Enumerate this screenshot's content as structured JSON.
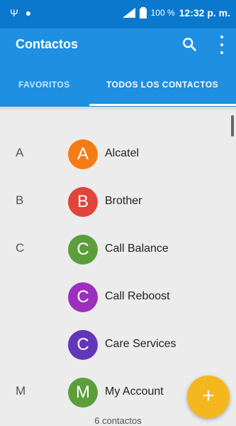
{
  "status_bar": {
    "battery": "100 %",
    "time": "12:32 p. m."
  },
  "app_bar": {
    "title": "Contactos"
  },
  "tabs": [
    {
      "label": "FAVORITOS"
    },
    {
      "label": "TODOS LOS CONTACTOS"
    }
  ],
  "contacts": [
    {
      "section": "A",
      "initial": "A",
      "name": "Alcatel",
      "color": "#f57c14"
    },
    {
      "section": "B",
      "initial": "B",
      "name": "Brother",
      "color": "#e0443a"
    },
    {
      "section": "C",
      "initial": "C",
      "name": "Call Balance",
      "color": "#5c9e3c"
    },
    {
      "section": "",
      "initial": "C",
      "name": "Call Reboost",
      "color": "#9c2fbd"
    },
    {
      "section": "",
      "initial": "C",
      "name": "Care Services",
      "color": "#6236b9"
    },
    {
      "section": "M",
      "initial": "M",
      "name": "My Account",
      "color": "#5c9e3c"
    }
  ],
  "footer": {
    "count": "6 contactos"
  },
  "fab": {
    "label": "+",
    "color": "#f4b81e"
  }
}
